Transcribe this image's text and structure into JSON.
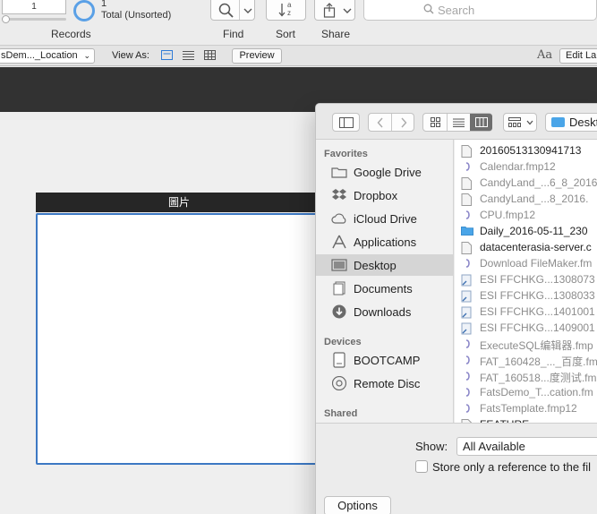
{
  "toolbar": {
    "record_field": "1",
    "records_label": "Records",
    "found_count": "1",
    "found_status": "Total (Unsorted)",
    "find_label": "Find",
    "sort_label": "Sort",
    "share_label": "Share",
    "search_placeholder": "Search",
    "sort_glyph_top": "a",
    "sort_glyph_bottom": "z"
  },
  "layoutbar": {
    "layout_name": "sDem..._Location",
    "view_as_label": "View As:",
    "preview_label": "Preview",
    "edit_layout_label": "Edit La",
    "text_format_glyph": "Aa"
  },
  "field": {
    "header_label": "圖片"
  },
  "dialog": {
    "path_folder": "Deskt",
    "sidebar": {
      "favorites_label": "Favorites",
      "favorites": [
        {
          "label": "Google Drive",
          "icon": "folder-icon"
        },
        {
          "label": "Dropbox",
          "icon": "dropbox-icon"
        },
        {
          "label": "iCloud Drive",
          "icon": "cloud-icon"
        },
        {
          "label": "Applications",
          "icon": "applications-icon"
        },
        {
          "label": "Desktop",
          "icon": "desktop-icon",
          "selected": true
        },
        {
          "label": "Documents",
          "icon": "documents-icon"
        },
        {
          "label": "Downloads",
          "icon": "downloads-icon"
        }
      ],
      "devices_label": "Devices",
      "devices": [
        {
          "label": "BOOTCAMP",
          "icon": "disk-icon"
        },
        {
          "label": "Remote Disc",
          "icon": "disc-icon"
        }
      ],
      "shared_label": "Shared"
    },
    "files": [
      {
        "name": "20160513130941713",
        "dim": false,
        "icon": "document-icon"
      },
      {
        "name": "Calendar.fmp12",
        "dim": true,
        "icon": "filemaker-icon"
      },
      {
        "name": "CandyLand_...6_8_2016",
        "dim": true,
        "icon": "document-icon"
      },
      {
        "name": "CandyLand_...8_2016.",
        "dim": true,
        "icon": "document-icon"
      },
      {
        "name": "CPU.fmp12",
        "dim": true,
        "icon": "filemaker-icon"
      },
      {
        "name": "Daily_2016-05-11_230",
        "dim": false,
        "icon": "folder-icon"
      },
      {
        "name": "datacenterasia-server.c",
        "dim": false,
        "icon": "document-icon"
      },
      {
        "name": "Download FileMaker.fm",
        "dim": true,
        "icon": "filemaker-icon"
      },
      {
        "name": "ESI FFCHKG...1308073",
        "dim": true,
        "icon": "alias-icon"
      },
      {
        "name": "ESI FFCHKG...1308033",
        "dim": true,
        "icon": "alias-icon"
      },
      {
        "name": "ESI FFCHKG...1401001",
        "dim": true,
        "icon": "alias-icon"
      },
      {
        "name": "ESI FFCHKG...1409001",
        "dim": true,
        "icon": "alias-icon"
      },
      {
        "name": "ExecuteSQL编辑器.fmp",
        "dim": true,
        "icon": "filemaker-icon"
      },
      {
        "name": "FAT_160428_..._百度.fm",
        "dim": true,
        "icon": "filemaker-icon"
      },
      {
        "name": "FAT_160518...度测试.fm",
        "dim": true,
        "icon": "filemaker-icon"
      },
      {
        "name": "FatsDemo_T...cation.fm",
        "dim": true,
        "icon": "filemaker-icon"
      },
      {
        "name": "FatsTemplate.fmp12",
        "dim": true,
        "icon": "filemaker-icon"
      },
      {
        "name": "FEATURE.....",
        "dim": false,
        "icon": "document-icon"
      }
    ],
    "show_label": "Show:",
    "show_value": "All Available",
    "store_reference_label": "Store only a reference to the fil",
    "options_label": "Options"
  },
  "colors": {
    "accent": "#3c78c3",
    "dark_band": "#323232",
    "field_header": "#262626"
  }
}
